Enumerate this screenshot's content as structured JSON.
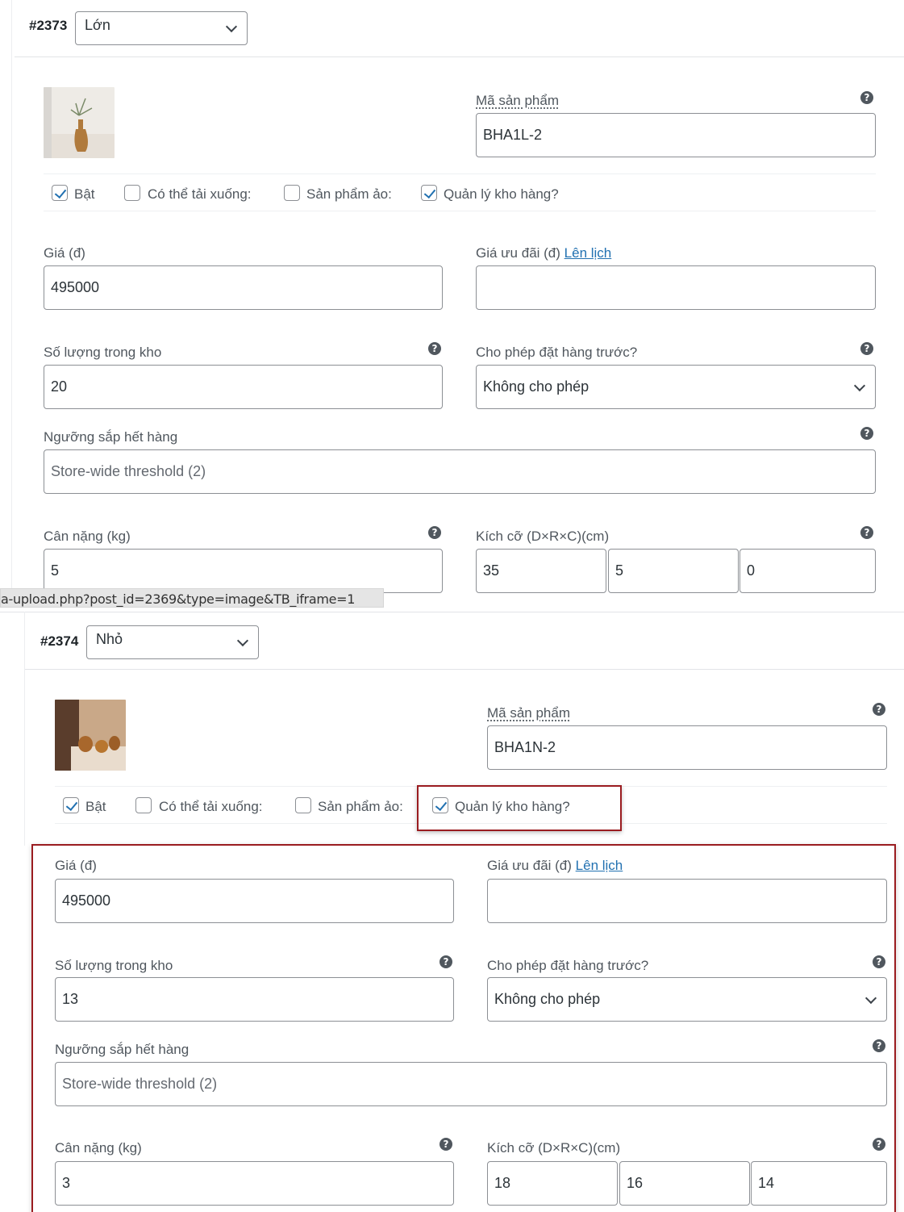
{
  "status_url": "a-upload.php?post_id=2369&type=image&TB_iframe=1",
  "icons": {
    "help": "question-circle-icon",
    "dropdown": "chevron-down-icon",
    "checkbox": "checkmark-icon"
  },
  "highlight_color": "#9a1c20",
  "variations": [
    {
      "id": "#2373",
      "attribute_value": "Lớn",
      "sku_label": "Mã sản phẩm",
      "sku": "BHA1L-2",
      "options": [
        {
          "label": "Bật",
          "checked": true
        },
        {
          "label": "Có thể tải xuống:",
          "checked": false
        },
        {
          "label": "Sản phẩm ảo:",
          "checked": false
        },
        {
          "label": "Quản lý kho hàng?",
          "checked": true
        }
      ],
      "price_label": "Giá (đ)",
      "price": "495000",
      "sale_label": "Giá ưu đãi (đ)",
      "schedule_link": "Lên lịch",
      "sale_price": "",
      "stock_label": "Số lượng trong kho",
      "stock": "20",
      "backorders_label": "Cho phép đặt hàng trước?",
      "backorders": "Không cho phép",
      "low_stock_label": "Ngưỡng sắp hết hàng",
      "low_stock_placeholder": "Store-wide threshold (2)",
      "weight_label": "Cân nặng (kg)",
      "weight": "5",
      "dimensions_label": "Kích cỡ (D×R×C)(cm)",
      "length": "35",
      "width": "5",
      "height": "0"
    },
    {
      "id": "#2374",
      "attribute_value": "Nhỏ",
      "sku_label": "Mã sản phẩm",
      "sku": "BHA1N-2",
      "options": [
        {
          "label": "Bật",
          "checked": true
        },
        {
          "label": "Có thể tải xuống:",
          "checked": false
        },
        {
          "label": "Sản phẩm ảo:",
          "checked": false
        },
        {
          "label": "Quản lý kho hàng?",
          "checked": true
        }
      ],
      "price_label": "Giá (đ)",
      "price": "495000",
      "sale_label": "Giá ưu đãi (đ)",
      "schedule_link": "Lên lịch",
      "sale_price": "",
      "stock_label": "Số lượng trong kho",
      "stock": "13",
      "backorders_label": "Cho phép đặt hàng trước?",
      "backorders": "Không cho phép",
      "low_stock_label": "Ngưỡng sắp hết hàng",
      "low_stock_placeholder": "Store-wide threshold (2)",
      "weight_label": "Cân nặng (kg)",
      "weight": "3",
      "dimensions_label": "Kích cỡ (D×R×C)(cm)",
      "length": "18",
      "width": "16",
      "height": "14"
    }
  ]
}
